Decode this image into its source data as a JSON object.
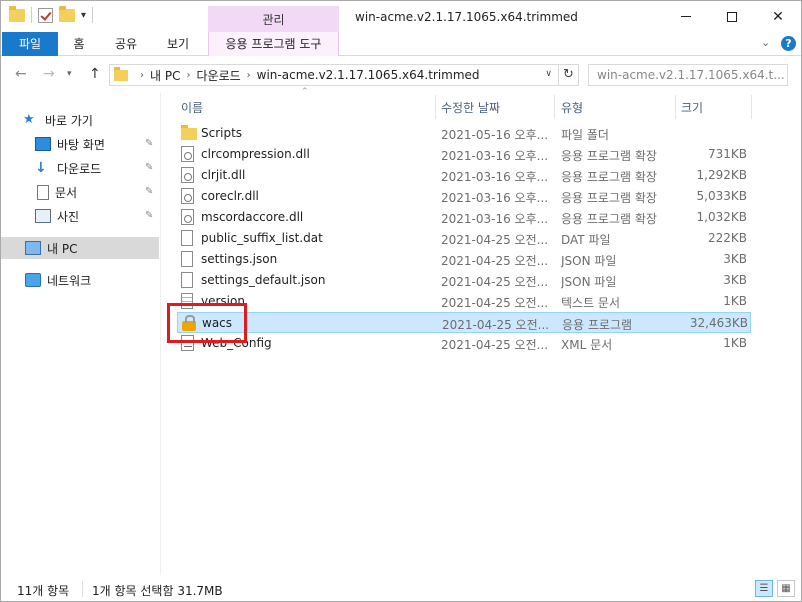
{
  "window": {
    "title": "win-acme.v2.1.17.1065.x64.trimmed",
    "context_tab_group": "관리"
  },
  "ribbon": {
    "tabs": [
      "파일",
      "홈",
      "공유",
      "보기",
      "응용 프로그램 도구"
    ]
  },
  "address": {
    "crumbs": [
      "내 PC",
      "다운로드",
      "win-acme.v2.1.17.1065.x64.trimmed"
    ],
    "search_placeholder": "win-acme.v2.1.17.1065.x64.t..."
  },
  "navpane": {
    "quick_access": "바로 가기",
    "items": [
      "바탕 화면",
      "다운로드",
      "문서",
      "사진"
    ],
    "this_pc": "내 PC",
    "network": "네트워크"
  },
  "columns": {
    "name": "이름",
    "date": "수정한 날짜",
    "type": "유형",
    "size": "크기"
  },
  "files": [
    {
      "name": "Scripts",
      "date": "2021-05-16 오후...",
      "type": "파일 폴더",
      "size": "",
      "icon": "folder-icon"
    },
    {
      "name": "clrcompression.dll",
      "date": "2021-03-16 오후...",
      "type": "응용 프로그램 확장",
      "size": "731KB",
      "icon": "dll-icon"
    },
    {
      "name": "clrjit.dll",
      "date": "2021-03-16 오후...",
      "type": "응용 프로그램 확장",
      "size": "1,292KB",
      "icon": "dll-icon"
    },
    {
      "name": "coreclr.dll",
      "date": "2021-03-16 오후...",
      "type": "응용 프로그램 확장",
      "size": "5,033KB",
      "icon": "dll-icon"
    },
    {
      "name": "mscordaccore.dll",
      "date": "2021-03-16 오후...",
      "type": "응용 프로그램 확장",
      "size": "1,032KB",
      "icon": "dll-icon"
    },
    {
      "name": "public_suffix_list.dat",
      "date": "2021-04-25 오전...",
      "type": "DAT 파일",
      "size": "222KB",
      "icon": "document-icon"
    },
    {
      "name": "settings.json",
      "date": "2021-04-25 오전...",
      "type": "JSON 파일",
      "size": "3KB",
      "icon": "document-icon"
    },
    {
      "name": "settings_default.json",
      "date": "2021-04-25 오전...",
      "type": "JSON 파일",
      "size": "3KB",
      "icon": "document-icon"
    },
    {
      "name": "version",
      "date": "2021-04-25 오전...",
      "type": "텍스트 문서",
      "size": "1KB",
      "icon": "text-file-icon"
    },
    {
      "name": "wacs",
      "date": "2021-04-25 오전...",
      "type": "응용 프로그램",
      "size": "32,463KB",
      "icon": "lock-icon"
    },
    {
      "name": "Web_Config",
      "date": "2021-04-25 오전...",
      "type": "XML 문서",
      "size": "1KB",
      "icon": "xml-icon"
    }
  ],
  "status": {
    "item_count": "11개 항목",
    "selection": "1개 항목 선택함 31.7MB"
  },
  "colors": {
    "file_tab": "#1979ca",
    "context_tab": "#f2d9f5",
    "selection": "#cce8ff",
    "highlight_box": "#e01b1b"
  }
}
